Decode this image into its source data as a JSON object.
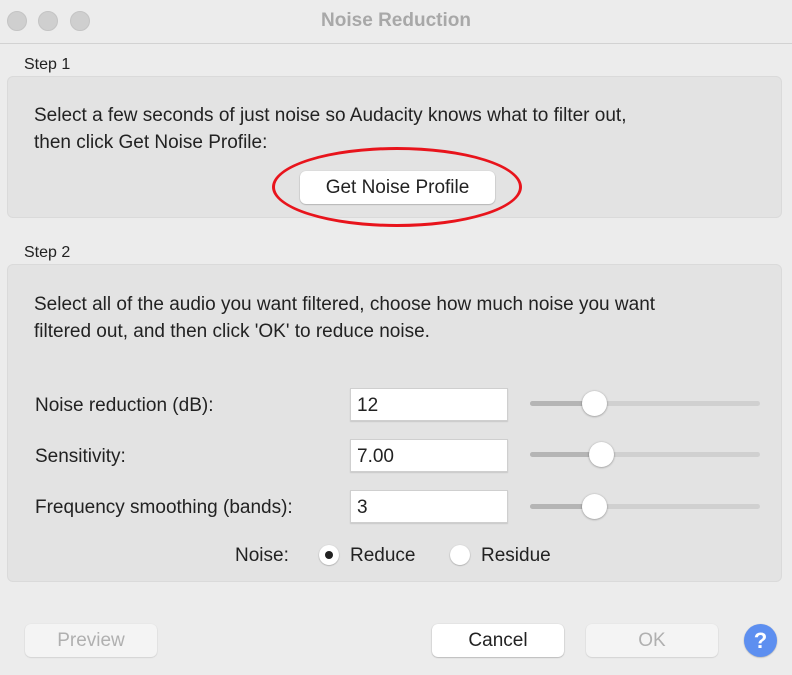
{
  "window": {
    "title": "Noise Reduction",
    "traffic_lights": [
      "close",
      "minimize",
      "zoom"
    ]
  },
  "step1": {
    "label": "Step 1",
    "instructions_line1": "Select a few seconds of just noise so Audacity knows what to filter out,",
    "instructions_line2": "then click Get Noise Profile:",
    "get_profile_button": "Get Noise Profile"
  },
  "step2": {
    "label": "Step 2",
    "instructions_line1": "Select all of the audio you want filtered, choose how much noise you want",
    "instructions_line2": "filtered out, and then click 'OK' to reduce noise.",
    "params": [
      {
        "label": "Noise reduction (dB):",
        "value": "12",
        "slider_fraction": 0.28
      },
      {
        "label": "Sensitivity:",
        "value": "7.00",
        "slider_fraction": 0.31
      },
      {
        "label": "Frequency smoothing (bands):",
        "value": "3",
        "slider_fraction": 0.28
      }
    ],
    "noise_label": "Noise:",
    "noise_options": [
      {
        "label": "Reduce",
        "selected": true
      },
      {
        "label": "Residue",
        "selected": false
      }
    ]
  },
  "footer": {
    "preview": "Preview",
    "cancel": "Cancel",
    "ok": "OK",
    "help": "?"
  },
  "annotation": {
    "color": "#e8141c",
    "target": "get-noise-profile-button"
  }
}
